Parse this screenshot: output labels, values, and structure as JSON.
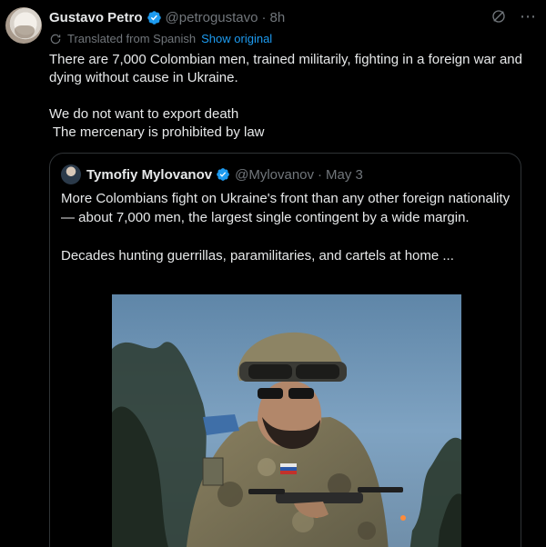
{
  "tweet": {
    "author_name": "Gustavo Petro",
    "handle": "@petrogustavo",
    "separator": "·",
    "time": "8h",
    "translated_label": "Translated from Spanish",
    "show_original": "Show original",
    "text_line1": "There are 7,000 Colombian men, trained militarily, fighting in a foreign war and dying without cause in Ukraine.",
    "text_line2": "We do not want to export death",
    "text_line3": " The mercenary is prohibited by law"
  },
  "quote": {
    "author_name": "Tymofiy Mylovanov",
    "handle": "@Mylovanov",
    "separator": "·",
    "date": "May 3",
    "text_para1": "More Colombians fight on Ukraine's front than any other foreign nationality — about 7,000 men, the largest single contingent by a wide margin.",
    "text_para2": "Decades hunting guerrillas, paramilitaries, and cartels at home ..."
  },
  "colors": {
    "background": "#000000",
    "text": "#e7e9ea",
    "muted": "#71767b",
    "link": "#1d9bf0",
    "verified": "#1d9bf0",
    "border": "#2f3336"
  },
  "icons": {
    "verified": "verified-badge-icon",
    "grok": "grok-icon",
    "more": "more-icon",
    "translate": "translate-icon"
  }
}
